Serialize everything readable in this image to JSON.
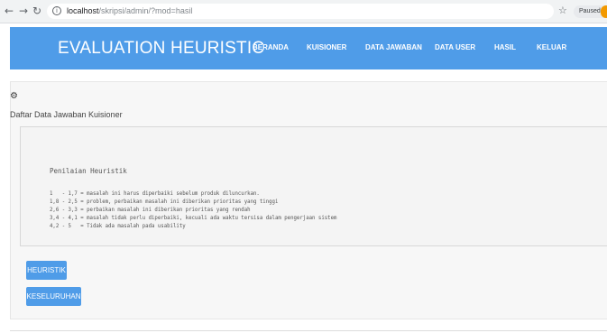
{
  "browser": {
    "url_host": "localhost",
    "url_path": "/skripsi/admin/?mod=hasil",
    "paused_label": "Paused"
  },
  "header": {
    "brand": "EVALUATION HEURISTIC",
    "nav": [
      "BERANDA",
      "KUISIONER",
      "DATA JAWABAN",
      "DATA USER",
      "HASIL",
      "KELUAR"
    ]
  },
  "main": {
    "page_title": "Daftar Data Jawaban Kuisioner",
    "panel_title": "Penilaian Heuristik",
    "criteria": [
      "1   - 1,7 = masalah ini harus diperbaiki sebelum produk diluncurkan.",
      "1,8 - 2,5 = problem, perbaikan masalah ini diberikan prioritas yang tinggi",
      "2,6 - 3,3 = perbaikan masalah ini diberikan prioritas yang rendah",
      "3,4 - 4,1 = masalah tidak perlu diperbaiki, kecuali ada waktu tersisa dalam pengerjaan sistem",
      "4,2 - 5   = Tidak ada masalah pada usability"
    ],
    "buttons": {
      "heuristik": "HEURISTIK",
      "keseluruhan": "KESELURUHAN"
    }
  },
  "colors": {
    "accent": "#4f9ce8",
    "paused_badge": "#f29900"
  }
}
